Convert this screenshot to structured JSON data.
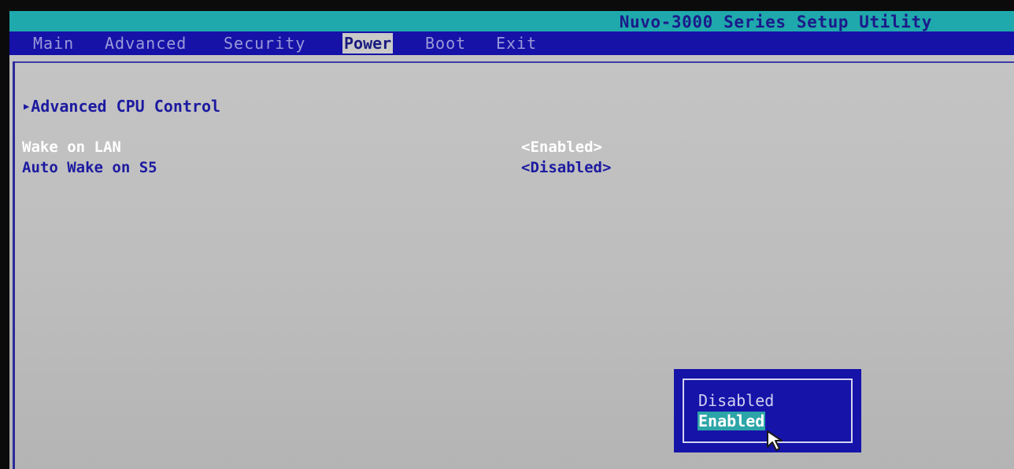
{
  "window": {
    "title": "Nuvo-3000 Series Setup Utility"
  },
  "menu": {
    "tabs": [
      {
        "label": "Main"
      },
      {
        "label": "Advanced"
      },
      {
        "label": "Security"
      },
      {
        "label": "Power"
      },
      {
        "label": "Boot"
      },
      {
        "label": "Exit"
      }
    ],
    "active": "Power"
  },
  "power": {
    "submenu": {
      "label": "Advanced CPU Control"
    },
    "settings": [
      {
        "label": "Wake on LAN",
        "value": "<Enabled>"
      },
      {
        "label": "Auto Wake on S5",
        "value": "<Disabled>"
      }
    ]
  },
  "popup": {
    "options": [
      {
        "label": "Disabled"
      },
      {
        "label": "Enabled"
      }
    ],
    "selected": "Enabled"
  },
  "colors": {
    "title_bar": "#1fa9ac",
    "menu_bar": "#1612a8",
    "content_bg": "#bfbfbf",
    "text_blue": "#1c1aa0",
    "highlight": "#2ca5a8",
    "popup_bg": "#1513a8"
  },
  "icons": {
    "submenu_arrow": "right-triangle-icon",
    "pointer": "mouse-cursor-icon"
  }
}
